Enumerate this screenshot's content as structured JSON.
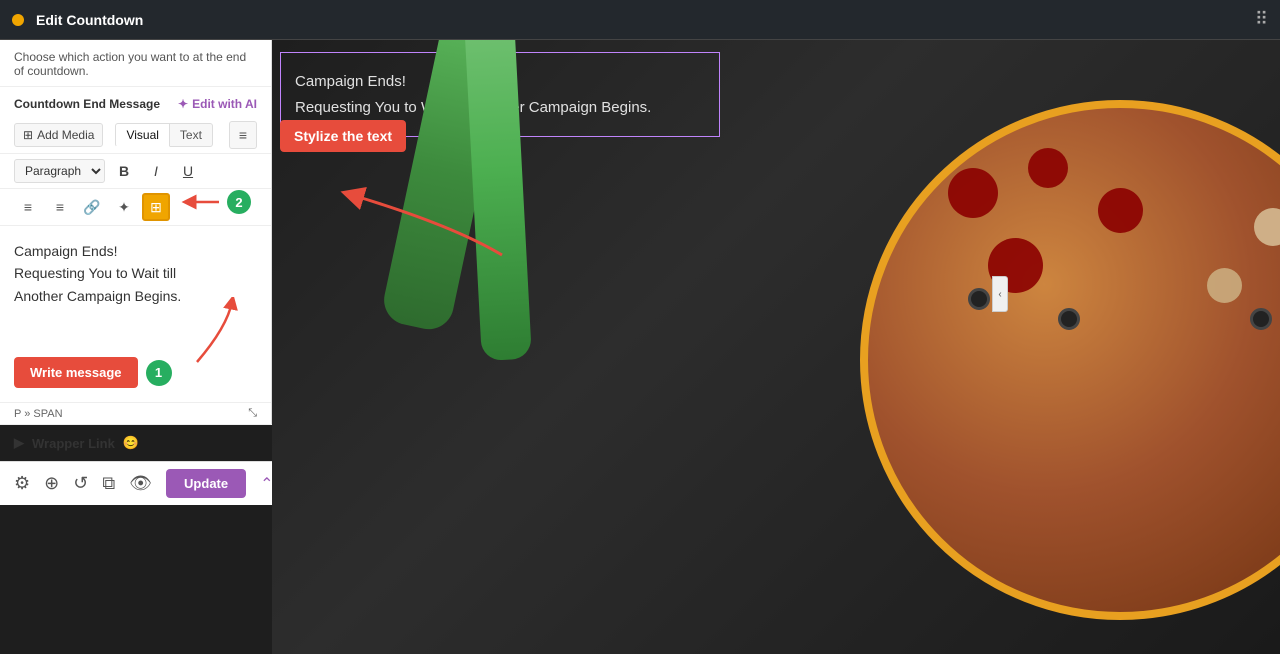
{
  "topbar": {
    "title": "Edit Countdown",
    "dot_color": "#f0a500"
  },
  "sidebar": {
    "description": "Choose which action you want to at the end of countdown.",
    "section_label": "Countdown End Message",
    "edit_ai_label": "Edit with AI",
    "add_media_label": "Add Media",
    "view_tabs": [
      {
        "label": "Visual",
        "active": true
      },
      {
        "label": "Text",
        "active": false
      }
    ],
    "paragraph_label": "Paragraph",
    "format_buttons": [
      "B",
      "I",
      "U"
    ],
    "editor_content_line1": "Campaign Ends!",
    "editor_content_line2": "Requesting You to Wait till",
    "editor_content_line3": "Another Campaign Begins.",
    "write_message_label": "Write message",
    "badge1": "1",
    "badge2": "2",
    "status_text": "P » SPAN",
    "wrapper_link_label": "Wrapper Link",
    "wrapper_emoji": "😊"
  },
  "annotations": {
    "stylize_text_label": "Stylize the text",
    "write_message_label": "Write message"
  },
  "bottom_toolbar": {
    "update_label": "Update"
  },
  "preview": {
    "text_line1": "Campaign Ends!",
    "text_line2": "Requesting You to Wait till Another Campaign Begins."
  }
}
